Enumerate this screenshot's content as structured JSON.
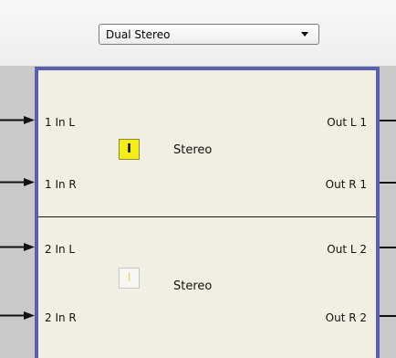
{
  "mode_select": {
    "value": "Dual Stereo"
  },
  "channels": [
    {
      "in_left": "1 In L",
      "in_right": "1 In R",
      "out_left": "Out L 1",
      "out_right": "Out R 1",
      "toggle_label": "I",
      "toggle_active": true,
      "mode_label": "Stereo"
    },
    {
      "in_left": "2 In L",
      "in_right": "2 In R",
      "out_left": "Out L 2",
      "out_right": "Out R 2",
      "toggle_label": "I",
      "toggle_active": false,
      "mode_label": "Stereo"
    }
  ],
  "colors": {
    "panel_border": "#5b5fb0",
    "panel_background": "#f1efe3",
    "toggle_on": "#f5ee16",
    "toggle_off": "#f7f7f2"
  }
}
